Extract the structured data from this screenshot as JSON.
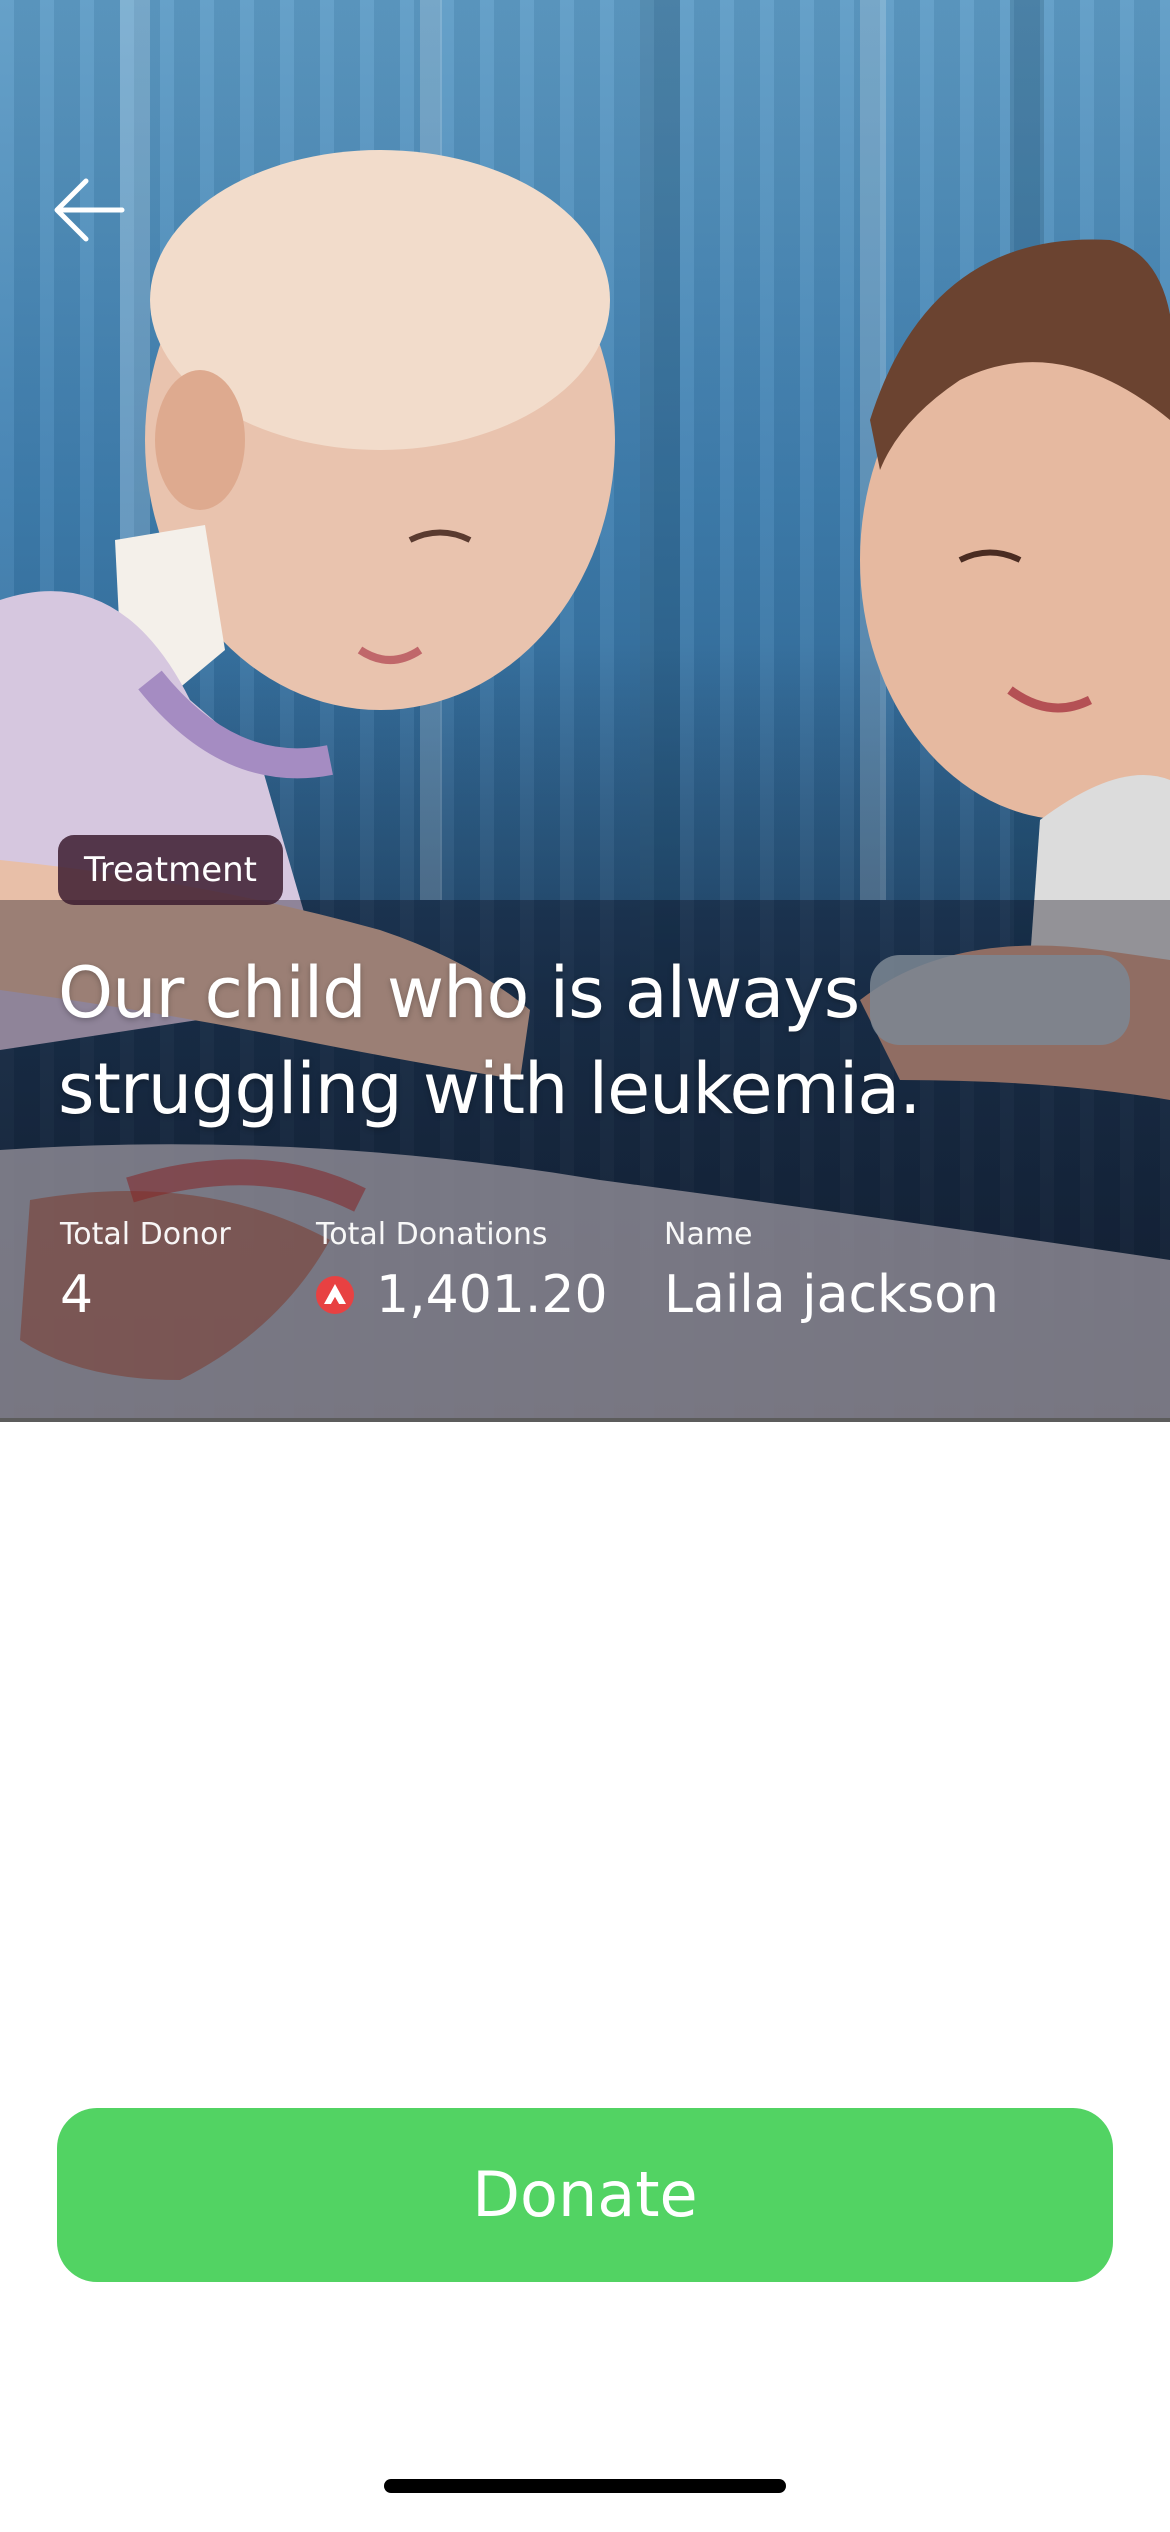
{
  "hero": {
    "image_description_icon": "photo-children-hospital",
    "category": "Treatment",
    "title": "Our child who is always struggling with leukemia."
  },
  "stats": {
    "total_donor_label": "Total Donor",
    "total_donor_value": "4",
    "total_donations_label": "Total Donations",
    "total_donations_value": "1,401.20",
    "currency_icon": "avalanche-icon",
    "name_label": "Name",
    "name_value": "Laila jackson"
  },
  "actions": {
    "donate_label": "Donate"
  },
  "colors": {
    "donate_button": "#52d363",
    "chip_background": "#3c1c30",
    "currency_icon": "#e84142"
  }
}
